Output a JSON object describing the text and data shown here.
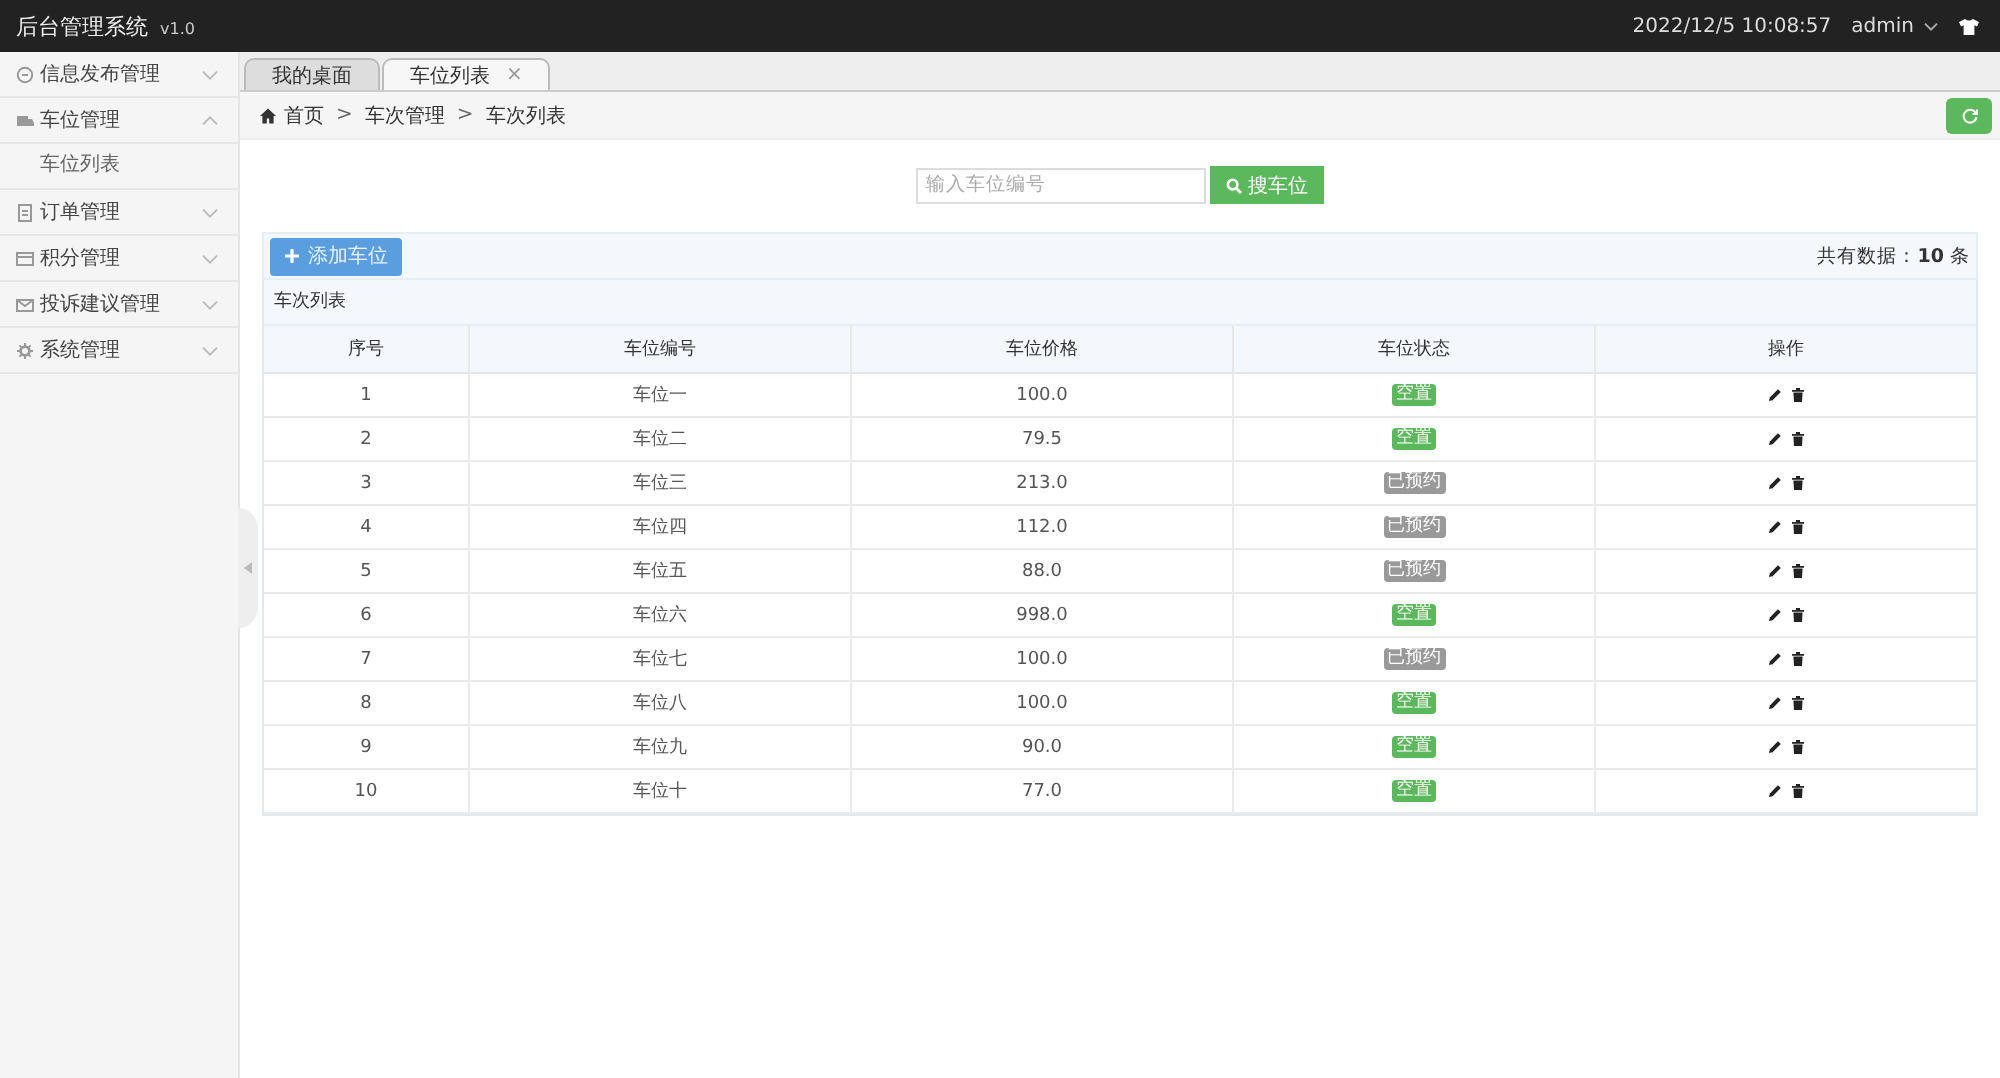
{
  "header": {
    "title": "后台管理系统",
    "version": "v1.0",
    "datetime": "2022/12/5 10:08:57",
    "user": "admin"
  },
  "sidebar": {
    "items": [
      {
        "label": "信息发布管理",
        "expanded": false
      },
      {
        "label": "车位管理",
        "expanded": true,
        "children": [
          {
            "label": "车位列表"
          }
        ]
      },
      {
        "label": "订单管理",
        "expanded": false
      },
      {
        "label": "积分管理",
        "expanded": false
      },
      {
        "label": "投诉建议管理",
        "expanded": false
      },
      {
        "label": "系统管理",
        "expanded": false
      }
    ]
  },
  "tabs": [
    {
      "label": "我的桌面",
      "selected": false,
      "closable": false
    },
    {
      "label": "车位列表",
      "selected": true,
      "closable": true
    }
  ],
  "close_glyph": "×",
  "breadcrumb": [
    "首页",
    "车次管理",
    "车次列表"
  ],
  "breadcrumb_separator": ">",
  "search": {
    "placeholder": "输入车位编号",
    "button": "搜车位"
  },
  "add_button": "添加车位",
  "total": {
    "label": "共有数据：",
    "count": "10",
    "unit": "条"
  },
  "table": {
    "title": "车次列表",
    "columns": [
      "序号",
      "车位编号",
      "车位价格",
      "车位状态",
      "操作"
    ],
    "rows": [
      {
        "no": "1",
        "code": "车位一",
        "price": "100.0",
        "status": {
          "kind": "free",
          "label": "空置"
        }
      },
      {
        "no": "2",
        "code": "车位二",
        "price": "79.5",
        "status": {
          "kind": "free",
          "label": "空置"
        }
      },
      {
        "no": "3",
        "code": "车位三",
        "price": "213.0",
        "status": {
          "kind": "reserved",
          "label": "已预约"
        }
      },
      {
        "no": "4",
        "code": "车位四",
        "price": "112.0",
        "status": {
          "kind": "reserved",
          "label": "已预约"
        }
      },
      {
        "no": "5",
        "code": "车位五",
        "price": "88.0",
        "status": {
          "kind": "reserved",
          "label": "已预约"
        }
      },
      {
        "no": "6",
        "code": "车位六",
        "price": "998.0",
        "status": {
          "kind": "free",
          "label": "空置"
        }
      },
      {
        "no": "7",
        "code": "车位七",
        "price": "100.0",
        "status": {
          "kind": "reserved",
          "label": "已预约"
        }
      },
      {
        "no": "8",
        "code": "车位八",
        "price": "100.0",
        "status": {
          "kind": "free",
          "label": "空置"
        }
      },
      {
        "no": "9",
        "code": "车位九",
        "price": "90.0",
        "status": {
          "kind": "free",
          "label": "空置"
        }
      },
      {
        "no": "10",
        "code": "车位十",
        "price": "77.0",
        "status": {
          "kind": "free",
          "label": "空置"
        }
      }
    ]
  }
}
